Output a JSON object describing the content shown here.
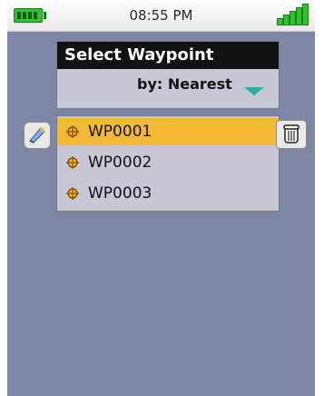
{
  "status": {
    "time": "08:55 PM"
  },
  "header": {
    "title": "Select Waypoint",
    "sort_label": "by: Nearest"
  },
  "waypoints": [
    {
      "name": "WP0001",
      "selected": true
    },
    {
      "name": "WP0002",
      "selected": false
    },
    {
      "name": "WP0003",
      "selected": false
    }
  ],
  "icons": {
    "battery": "battery-icon",
    "signal": "signal-icon",
    "waypoint": "waypoint-icon",
    "edit": "edit-icon",
    "trash": "trash-icon",
    "dropdown": "chevron-down-icon"
  },
  "colors": {
    "screen_bg": "#7d86a4",
    "panel_bg": "#c6c9d3",
    "title_bg": "#111111",
    "selected_row": "#f3b935",
    "accent": "#29b29e",
    "battery_green": "#33c133"
  }
}
